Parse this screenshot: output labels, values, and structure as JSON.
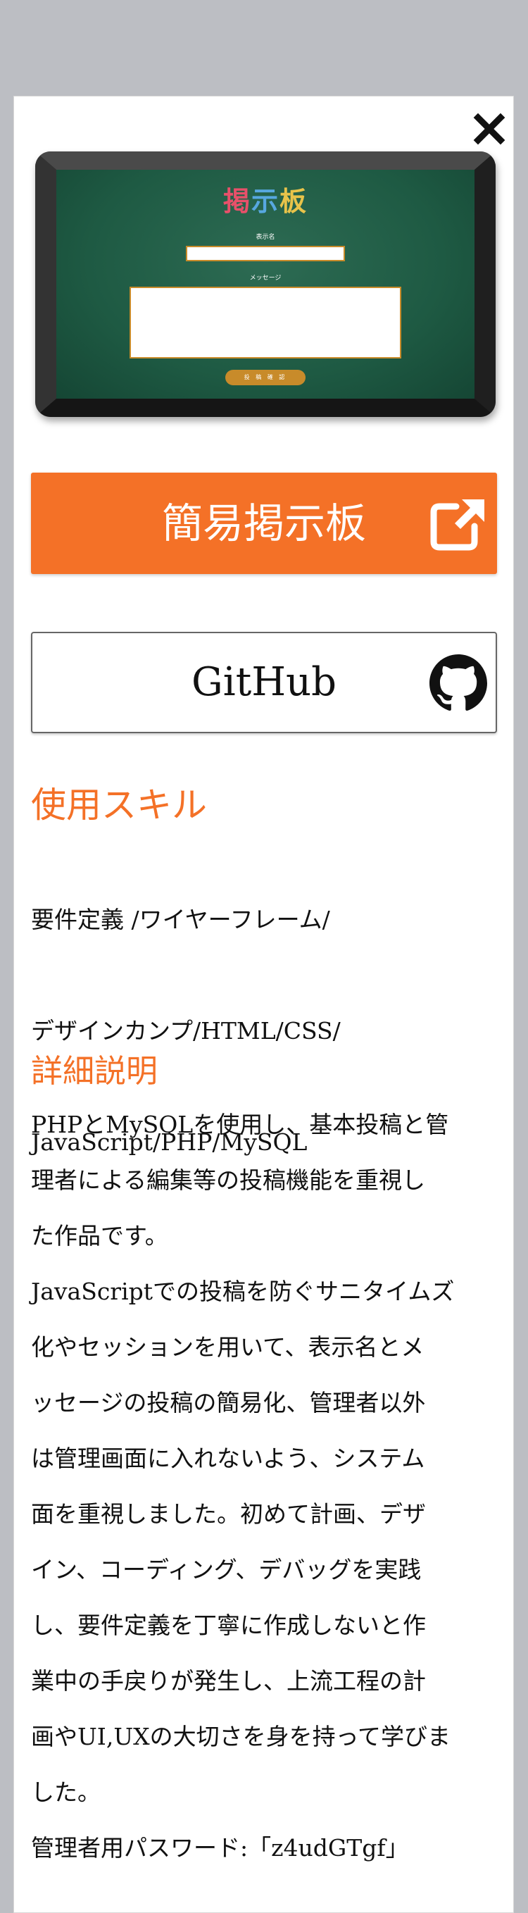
{
  "modal": {
    "close_label": "×"
  },
  "preview": {
    "board_title": [
      "掲",
      "示",
      "板"
    ],
    "name_label": "表示名",
    "message_label": "メッセージ",
    "submit_label": "投 稿 確 認"
  },
  "site_button": {
    "label": "簡易掲示板",
    "icon": "external-link-icon",
    "color": "#f47127"
  },
  "github_button": {
    "label": "GitHub",
    "icon": "github-icon"
  },
  "skills": {
    "heading": "使用スキル",
    "lines": [
      "要件定義 /ワイヤーフレーム/",
      "デザインカンプ/HTML/CSS/",
      "JavaScript/PHP/MySQL"
    ]
  },
  "detail": {
    "heading": "詳細説明",
    "lines": [
      "PHPとMySQLを使用し、基本投稿と管",
      "理者による編集等の投稿機能を重視し",
      "た作品です。",
      "JavaScriptでの投稿を防ぐサニタイムズ",
      "化やセッションを用いて、表示名とメ",
      "ッセージの投稿の簡易化、管理者以外",
      "は管理画面に入れないよう、システム",
      "面を重視しました。初めて計画、デザ",
      "イン、コーディング、デバッグを実践",
      "し、要件定義を丁寧に作成しないと作",
      "業中の手戻りが発生し、上流工程の計",
      "画やUI,UXの大切さを身を持って学びま",
      "した。",
      "管理者用パスワード:「z4udGTgf」"
    ]
  }
}
